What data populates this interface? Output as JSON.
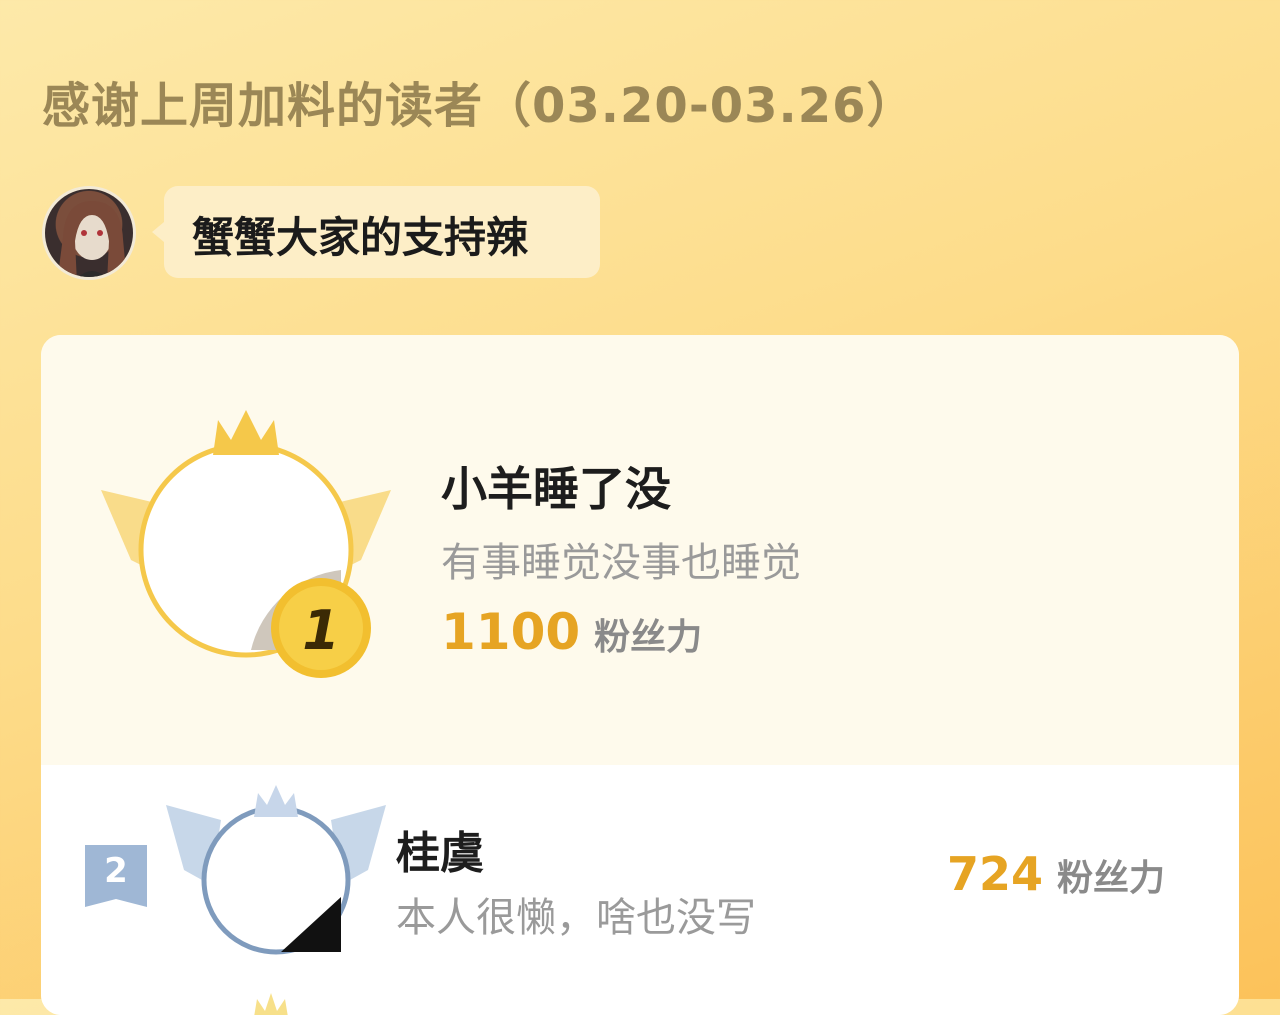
{
  "header": {
    "title": "感谢上周加料的读者（03.20-03.26）"
  },
  "author": {
    "message": "蟹蟹大家的支持辣"
  },
  "ranking": [
    {
      "rank": "1",
      "name": "小羊睡了没",
      "signature": "有事睡觉没事也睡觉",
      "score": "1100",
      "unit": "粉丝力"
    },
    {
      "rank": "2",
      "name": "桂虞",
      "signature": "本人很懒，啥也没写",
      "score": "724",
      "unit": "粉丝力"
    }
  ],
  "colors": {
    "accent": "#e6a423",
    "gold": "#f5c84a",
    "silver": "#8aa5c8"
  }
}
